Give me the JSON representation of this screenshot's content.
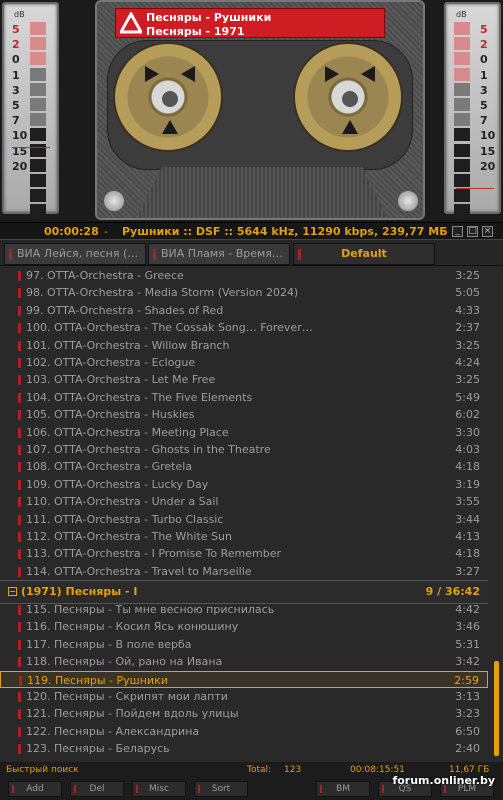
{
  "deck": {
    "vu_unit": "dB",
    "left_scale": [
      "5",
      "2",
      "0",
      "1",
      "3",
      "5",
      "7",
      "10",
      "15",
      "20"
    ],
    "right_scale": [
      "5",
      "2",
      "0",
      "1",
      "3",
      "5",
      "7",
      "10",
      "15",
      "20"
    ],
    "cassette_line1": "Песняры - Рушники",
    "cassette_line2": "Песняры - 1971"
  },
  "infoline": {
    "time": "00:00:28",
    "separator": "-",
    "text": "Рушники :: DSF :: 5644 kHz, 11290 kbps, 239,77 МБ ::"
  },
  "window_buttons": [
    "_",
    "□",
    "×"
  ],
  "tabs": [
    {
      "label": "ВИА Лейся, песня (…"
    },
    {
      "label": "ВИА Пламя - Время…"
    },
    {
      "label": "Default"
    }
  ],
  "playlist": {
    "rows_a": [
      {
        "n": "97.",
        "title": "OTTA-Orchestra - Greece",
        "dur": "3:25"
      },
      {
        "n": "98.",
        "title": "OTTA-Orchestra - Media Storm (Version 2024)",
        "dur": "5:05"
      },
      {
        "n": "99.",
        "title": "OTTA-Orchestra - Shades of Red",
        "dur": "4:33"
      },
      {
        "n": "100.",
        "title": "OTTA-Orchestra - The Cossak Song… Forever…",
        "dur": "2:37"
      },
      {
        "n": "101.",
        "title": "OTTA-Orchestra - Willow Branch",
        "dur": "3:25"
      },
      {
        "n": "102.",
        "title": "OTTA-Orchestra - Eclogue",
        "dur": "4:24"
      },
      {
        "n": "103.",
        "title": "OTTA-Orchestra - Let Me Free",
        "dur": "3:25"
      },
      {
        "n": "104.",
        "title": "OTTA-Orchestra - The Five Elements",
        "dur": "5:49"
      },
      {
        "n": "105.",
        "title": "OTTA-Orchestra - Huskies",
        "dur": "6:02"
      },
      {
        "n": "106.",
        "title": "OTTA-Orchestra - Meeting Place",
        "dur": "3:30"
      },
      {
        "n": "107.",
        "title": "OTTA-Orchestra - Ghosts in the Theatre",
        "dur": "4:03"
      },
      {
        "n": "108.",
        "title": "OTTA-Orchestra - Gretela",
        "dur": "4:18"
      },
      {
        "n": "109.",
        "title": "OTTA-Orchestra - Lucky Day",
        "dur": "3:19"
      },
      {
        "n": "110.",
        "title": "OTTA-Orchestra - Under a Sail",
        "dur": "3:55"
      },
      {
        "n": "111.",
        "title": "OTTA-Orchestra - Turbo Classic",
        "dur": "3:44"
      },
      {
        "n": "112.",
        "title": "OTTA-Orchestra - The White Sun",
        "dur": "4:13"
      },
      {
        "n": "113.",
        "title": "OTTA-Orchestra - I Promise To Remember",
        "dur": "4:18"
      },
      {
        "n": "114.",
        "title": "OTTA-Orchestra - Travel to Marseille",
        "dur": "3:27"
      }
    ],
    "group": {
      "label": "(1971) Песняры - I",
      "summary": "9 / 36:42"
    },
    "rows_b": [
      {
        "n": "115.",
        "title": "Песняры - Ты мне весною приснилась",
        "dur": "4:42"
      },
      {
        "n": "116.",
        "title": "Песняры - Косил Ясь конюшину",
        "dur": "3:46"
      },
      {
        "n": "117.",
        "title": "Песняры - В поле верба",
        "dur": "5:31"
      },
      {
        "n": "118.",
        "title": "Песняры - Ой, рано на Ивана",
        "dur": "3:42"
      },
      {
        "n": "119.",
        "title": "Песняры - Рушники",
        "dur": "2:59",
        "current": true
      },
      {
        "n": "120.",
        "title": "Песняры - Скрипят мои лапти",
        "dur": "3:13"
      },
      {
        "n": "121.",
        "title": "Песняры - Пойдем вдоль улицы",
        "dur": "3:23"
      },
      {
        "n": "122.",
        "title": "Песняры - Александрина",
        "dur": "6:50"
      },
      {
        "n": "123.",
        "title": "Песняры - Беларусь",
        "dur": "2:40"
      }
    ]
  },
  "status": {
    "search": "Быстрый поиск",
    "total_label": "Total:",
    "total_count": "123",
    "total_time": "00:08:15:51",
    "total_size": "11,67 ГБ"
  },
  "buttons": [
    "Add",
    "Del",
    "Misc",
    "Sort",
    "BM",
    "QS",
    "PLM"
  ],
  "watermark": "forum.onliner.by",
  "colors": {
    "accent": "#e0a10a",
    "marker": "#b02020",
    "label_red": "#d01d24"
  }
}
